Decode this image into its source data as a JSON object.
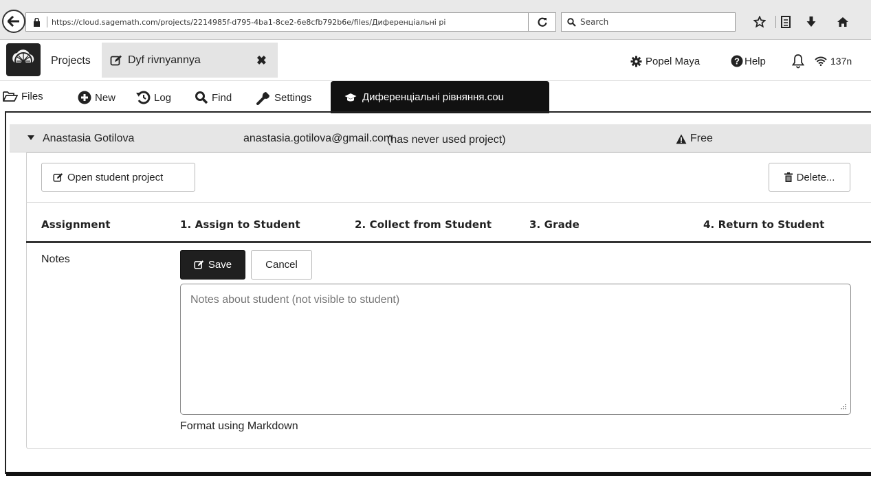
{
  "browser": {
    "url": "https://cloud.sagemath.com/projects/2214985f-d795-4ba1-8ce2-6e8cfb792b6e/files/Диференціальні рі",
    "url_domain": "sagemath",
    "search_placeholder": "Search"
  },
  "topbar": {
    "projects_label": "Projects",
    "project_tab_name": "Dyf rivnyannya",
    "close_glyph": "✖",
    "user_name": "Popel Maya",
    "help_label": "Help",
    "ping": "137n"
  },
  "file_nav": {
    "files": "Files",
    "new": "New",
    "log": "Log",
    "find": "Find",
    "settings": "Settings",
    "active_file": "Диференціальні рівняння.cou"
  },
  "student": {
    "name": "Anastasia Gotilova",
    "email": "anastasia.gotilova@gmail.com",
    "status": "(has never used project)",
    "plan": "Free",
    "open_button": "Open student project",
    "delete_button": "Delete..."
  },
  "assignments": {
    "columns": [
      "Assignment",
      "1. Assign to Student",
      "2. Collect from Student",
      "3. Grade",
      "4. Return to Student"
    ]
  },
  "notes": {
    "label": "Notes",
    "save": "Save",
    "cancel": "Cancel",
    "placeholder": "Notes about student (not visible to student)",
    "hint": "Format using Markdown"
  },
  "colors": {
    "active_tab_bg": "#111111",
    "save_bg": "#1f1f1f",
    "student_header_bg": "#e6e6e6"
  }
}
